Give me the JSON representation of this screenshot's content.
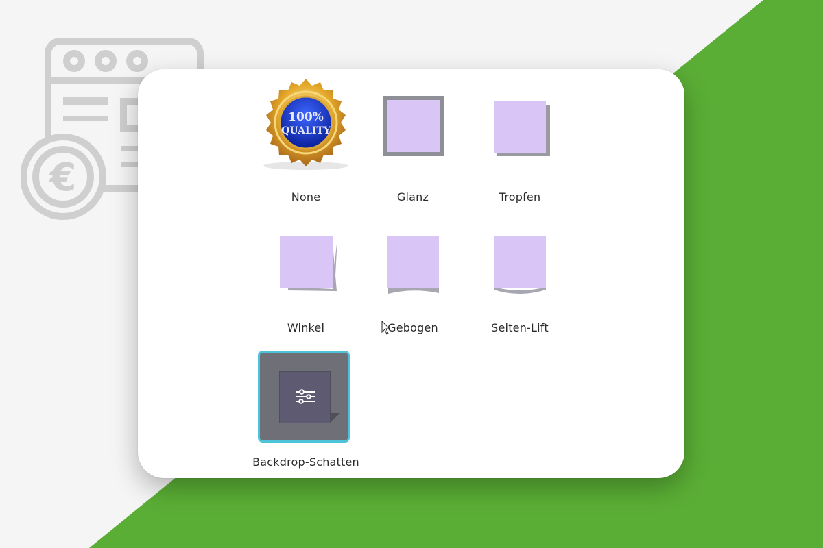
{
  "colors": {
    "green": "#5aae35",
    "swatch": "#d9c6f7",
    "shadow": "#8f8f98",
    "selected_border": "#4cc3d9",
    "selected_bg": "#6f6f78",
    "icon_grey": "#cfcfcf"
  },
  "background_icon": {
    "name": "invoice-euro-icon",
    "symbol": "€"
  },
  "badge": {
    "line1": "100%",
    "line2": "QUALITY"
  },
  "effects": [
    {
      "label": "None",
      "icon": "quality-badge-icon"
    },
    {
      "label": "Glanz",
      "icon": "glanz-shadow-icon"
    },
    {
      "label": "Tropfen",
      "icon": "tropfen-shadow-icon"
    },
    {
      "label": "Winkel",
      "icon": "winkel-shadow-icon"
    },
    {
      "label": "Gebogen",
      "icon": "gebogen-shadow-icon"
    },
    {
      "label": "Seiten-Lift",
      "icon": "seiten-lift-shadow-icon"
    },
    {
      "label": "Backdrop-Schatten",
      "icon": "sliders-icon",
      "selected": true
    }
  ]
}
